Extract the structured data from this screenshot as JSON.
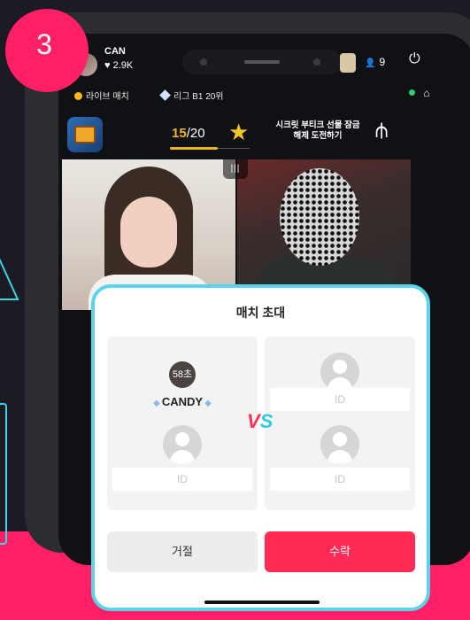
{
  "step_badge": "3",
  "colors": {
    "brand_pink": "#ff1f66",
    "accent_cyan": "#59d5ea",
    "accept_red": "#ff2b55",
    "progress_gold": "#f2b61d"
  },
  "status_bar": {
    "user_name": "CAN",
    "user_likes": "2.9K",
    "viewer_count": "9"
  },
  "info_row": {
    "left_label": "라이브 매치",
    "right_label": "리그 B1 20위"
  },
  "mission": {
    "progress_done": "15",
    "progress_total": "/20",
    "text": "시크릿 부티크 선물 잠금 해제 도전하기"
  },
  "modal": {
    "title": "매치 초대",
    "host": {
      "timer": "58초",
      "name": "CANDY"
    },
    "slots": [
      {
        "placeholder": "ID"
      },
      {
        "placeholder": "ID"
      },
      {
        "placeholder": "ID"
      }
    ],
    "vs_label": {
      "v": "V",
      "s": "S"
    },
    "reject_label": "거절",
    "accept_label": "수락"
  },
  "icons": {
    "likes": "heart-icon",
    "viewers": "person-icon",
    "exit": "exit-icon",
    "star": "star-icon",
    "trident": "trident-icon",
    "split": "split-screen-icon"
  }
}
